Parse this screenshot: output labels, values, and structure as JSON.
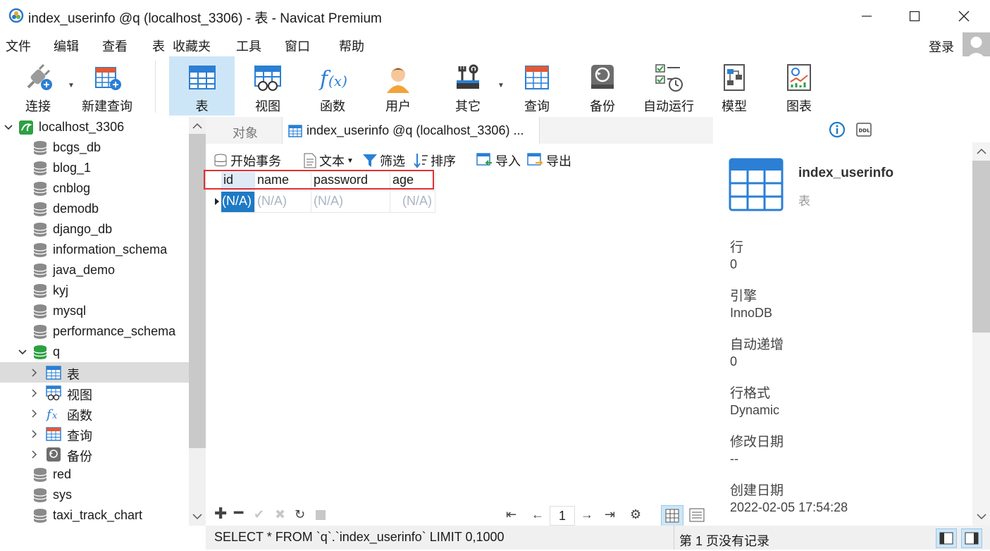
{
  "window": {
    "title": "index_userinfo @q (localhost_3306) - 表 - Navicat Premium"
  },
  "menu": [
    "文件",
    "编辑",
    "查看",
    "表",
    "收藏夹",
    "工具",
    "窗口",
    "帮助"
  ],
  "account": {
    "login_label": "登录"
  },
  "toolbar": [
    {
      "label": "连接",
      "icon": "plug-icon"
    },
    {
      "label": "新建查询",
      "icon": "new-query-icon"
    },
    {
      "label": "表",
      "icon": "table-icon"
    },
    {
      "label": "视图",
      "icon": "view-icon"
    },
    {
      "label": "函数",
      "icon": "function-icon"
    },
    {
      "label": "用户",
      "icon": "user-icon"
    },
    {
      "label": "其它",
      "icon": "tools-icon"
    },
    {
      "label": "查询",
      "icon": "query-icon"
    },
    {
      "label": "备份",
      "icon": "backup-icon"
    },
    {
      "label": "自动运行",
      "icon": "schedule-icon"
    },
    {
      "label": "模型",
      "icon": "model-icon"
    },
    {
      "label": "图表",
      "icon": "chart-icon"
    }
  ],
  "tree": {
    "connection": "localhost_3306",
    "databases": [
      "bcgs_db",
      "blog_1",
      "cnblog",
      "demodb",
      "django_db",
      "information_schema",
      "java_demo",
      "kyj",
      "mysql",
      "performance_schema"
    ],
    "open_db": "q",
    "open_db_children": [
      "表",
      "视图",
      "函数",
      "查询",
      "备份"
    ],
    "after": [
      "red",
      "sys",
      "taxi_track_chart"
    ]
  },
  "tabs": {
    "objects": "对象",
    "active": "index_userinfo @q (localhost_3306) ..."
  },
  "subtoolbar": {
    "begin_tx": "开始事务",
    "text": "文本",
    "filter": "筛选",
    "sort": "排序",
    "import": "导入",
    "export": "导出"
  },
  "grid": {
    "columns": [
      "id",
      "name",
      "password",
      "age"
    ],
    "row": [
      "(N/A)",
      "(N/A)",
      "(N/A)",
      "(N/A)"
    ],
    "page": "1"
  },
  "status": {
    "sql": "SELECT * FROM `q`.`index_userinfo` LIMIT 0,1000",
    "record": "第 1 页没有记录"
  },
  "info": {
    "name": "index_userinfo",
    "type": "表",
    "fields": [
      {
        "label": "行",
        "value": "0"
      },
      {
        "label": "引擎",
        "value": "InnoDB"
      },
      {
        "label": "自动递增",
        "value": "0"
      },
      {
        "label": "行格式",
        "value": "Dynamic"
      },
      {
        "label": "修改日期",
        "value": "--"
      },
      {
        "label": "创建日期",
        "value": "2022-02-05 17:54:28"
      }
    ]
  },
  "colors": {
    "accent": "#1e7ac5",
    "highlight_box": "#e03030",
    "db_green": "#2ea043",
    "selection": "#1e7ac5"
  }
}
